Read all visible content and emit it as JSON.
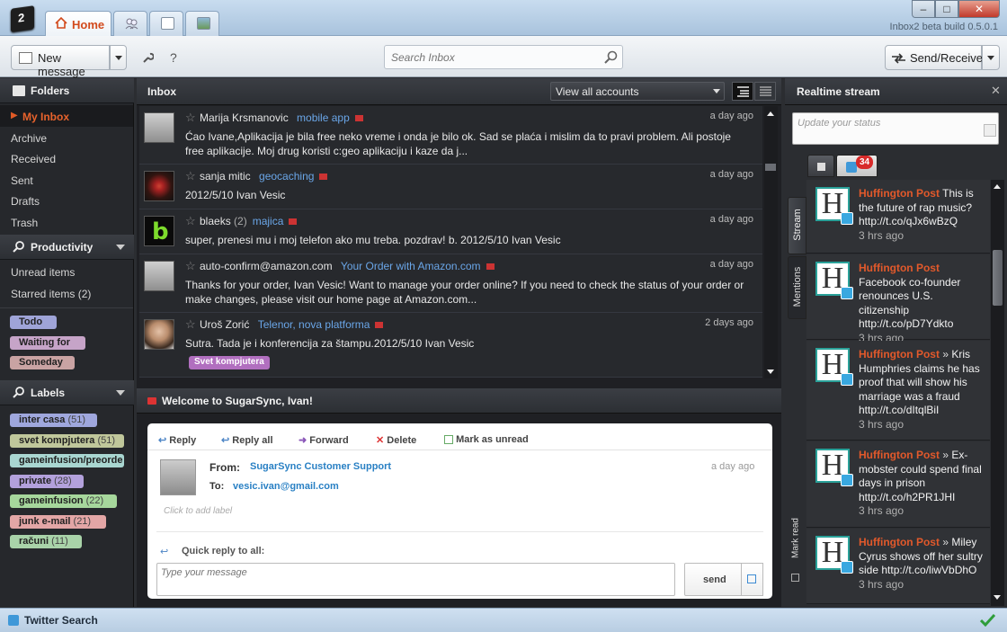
{
  "window": {
    "version": "Inbox2 beta build 0.5.0.1",
    "minimize": "‒",
    "maximize": "□",
    "close": "✕"
  },
  "tabs": {
    "home": "Home"
  },
  "toolbar": {
    "new_message": "New message",
    "help": "?",
    "search_placeholder": "Search Inbox",
    "send_receive": "Send/Receive"
  },
  "folders": {
    "header": "Folders",
    "items": [
      "My Inbox",
      "Archive",
      "Received",
      "Sent",
      "Drafts",
      "Trash"
    ]
  },
  "productivity": {
    "header": "Productivity",
    "unread": "Unread items",
    "starred": "Starred items",
    "starred_count": "(2)",
    "chips": [
      {
        "label": "Todo",
        "color": "#9fa4d8"
      },
      {
        "label": "Waiting for",
        "color": "#c6a4c8"
      },
      {
        "label": "Someday",
        "color": "#c9a3a3"
      }
    ]
  },
  "labels": {
    "header": "Labels",
    "items": [
      {
        "name": "inter casa",
        "count": "(51)",
        "color": "#9fa7dd"
      },
      {
        "name": "svet kompjutera",
        "count": "(51)",
        "color": "#c0c79b"
      },
      {
        "name": "gameinfusion/preorde",
        "count": "",
        "color": "#a9d6d1"
      },
      {
        "name": "private",
        "count": "(28)",
        "color": "#b3a1dc"
      },
      {
        "name": "gameinfusion",
        "count": "(22)",
        "color": "#a6d79c"
      },
      {
        "name": "junk e-mail",
        "count": "(21)",
        "color": "#e3a6a6"
      },
      {
        "name": "računi",
        "count": "(11)",
        "color": "#a9d3a9"
      }
    ]
  },
  "inbox": {
    "title": "Inbox",
    "accounts": "View all accounts",
    "messages": [
      {
        "sender": "Marija Krsmanovic",
        "count": "",
        "subject": "mobile app",
        "date": "a day ago",
        "body": "Ćao Ivane,Aplikacija je bila free neko vreme i onda je bilo ok. Sad se plaća i mislim da to pravi problem. Ali postoje free aplikacije. Moj drug koristi c:geo aplikaciju i kaze da j..."
      },
      {
        "sender": "sanja mitic",
        "count": "",
        "subject": "geocaching",
        "date": "a day ago",
        "body": "2012/5/10 Ivan Vesic"
      },
      {
        "sender": "blaeks",
        "count": "(2)",
        "subject": "majica",
        "date": "a day ago",
        "body": "super, prenesi mu i moj telefon ako mu treba. pozdrav! b. 2012/5/10 Ivan Vesic"
      },
      {
        "sender": "auto-confirm@amazon.com",
        "count": "",
        "subject": "Your Order with Amazon.com",
        "date": "a day ago",
        "body": "Thanks for your order, Ivan Vesic! Want to manage your order online? If you need to check the status of your order or make changes, please visit our home page at Amazon.com..."
      },
      {
        "sender": "Uroš Zorić",
        "count": "",
        "subject": "Telenor, nova platforma",
        "date": "2 days ago",
        "body": "Sutra. Tada je i konferencija za štampu.2012/5/10 Ivan Vesic",
        "tag": "Svet kompjutera"
      }
    ]
  },
  "reading": {
    "title": "Welcome to SugarSync, Ivan!",
    "actions": {
      "reply": "Reply",
      "reply_all": "Reply all",
      "forward": "Forward",
      "delete": "Delete",
      "mark_unread": "Mark as unread"
    },
    "from_label": "From:",
    "from": "SugarSync Customer Support",
    "to_label": "To:",
    "to": "vesic.ivan@gmail.com",
    "date": "a day ago",
    "add_label": "Click to add label",
    "quick_reply": "Quick reply to all:",
    "placeholder": "Type your message",
    "send": "send"
  },
  "stream": {
    "title": "Realtime stream",
    "status_placeholder": "Update your status",
    "badge": "34",
    "side_tabs": {
      "stream": "Stream",
      "mentions": "Mentions",
      "mark_read": "Mark read"
    },
    "tweets": [
      {
        "author": "Huffington Post",
        "sep": "",
        "text": "This is the future of rap music? http://t.co/qJx6wBzQ",
        "ago": "3 hrs ago"
      },
      {
        "author": "Huffington Post",
        "sep": "",
        "text": "Facebook co-founder renounces U.S. citizenship http://t.co/pD7Ydkto",
        "ago": "3 hrs ago"
      },
      {
        "author": "Huffington Post",
        "sep": "»",
        "text": "Kris Humphries claims he has proof that will show his marriage was a fraud http://t.co/dItqlBiI",
        "ago": "3 hrs ago"
      },
      {
        "author": "Huffington Post",
        "sep": "»",
        "text": "Ex-mobster could spend final days in prison http://t.co/h2PR1JHI",
        "ago": "3 hrs ago"
      },
      {
        "author": "Huffington Post",
        "sep": "»",
        "text": "Miley Cyrus shows off her sultry side http://t.co/liwVbDhO",
        "ago": "3 hrs ago"
      }
    ]
  },
  "statusbar": {
    "label": "Twitter Search"
  }
}
